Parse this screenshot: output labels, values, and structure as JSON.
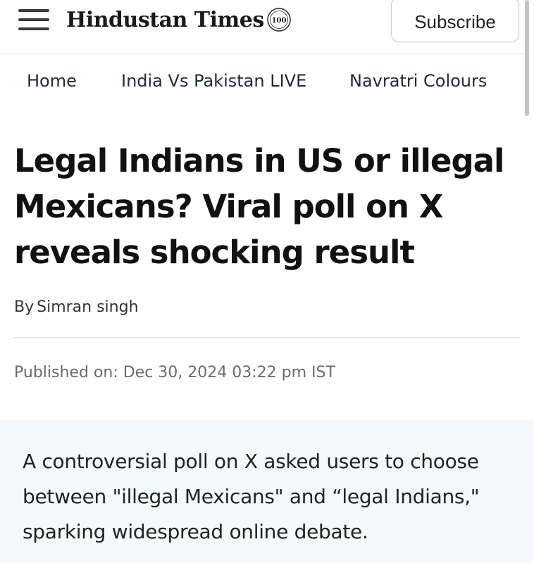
{
  "header": {
    "logo_text": "Hindustan Times",
    "logo_seal_text": "100",
    "subscribe_label": "Subscribe"
  },
  "nav": {
    "items": [
      {
        "label": "Home"
      },
      {
        "label": "India Vs Pakistan LIVE"
      },
      {
        "label": "Navratri Colours"
      }
    ]
  },
  "article": {
    "headline": "Legal Indians in US or illegal Mexicans? Viral poll on X reveals shocking result",
    "byline_prefix": "By",
    "author": "Simran singh",
    "published": "Published on: Dec 30, 2024 03:22 pm IST",
    "summary": "A controversial poll on X asked users to choose between \"illegal Mexicans\" and “legal Indians,\" sparking widespread online debate."
  },
  "icons": {
    "menu": "hamburger-menu-icon",
    "seal": "centenary-seal-icon"
  },
  "colors": {
    "summary_background": "#f2fafc",
    "nav_text": "#1c2a3a",
    "meta_text": "#6b6b6b"
  }
}
